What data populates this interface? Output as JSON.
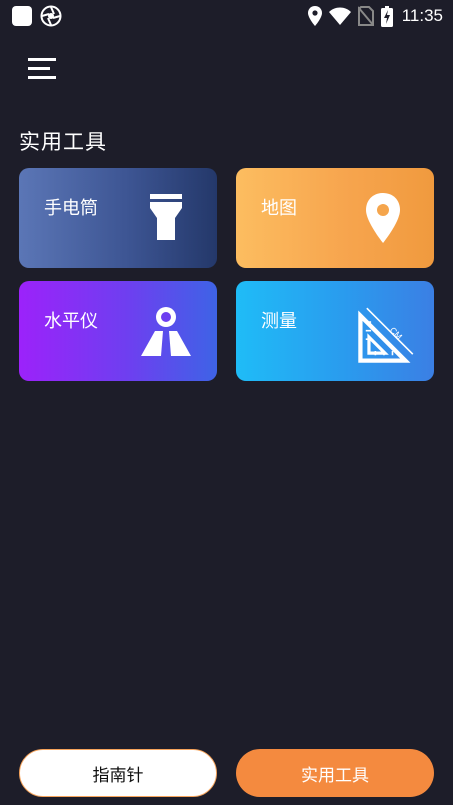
{
  "status_bar": {
    "time": "11:35",
    "icons": [
      "app-square-icon",
      "app-shutter-icon",
      "location-icon",
      "wifi-icon",
      "no-sim-icon",
      "battery-charging-icon"
    ]
  },
  "header": {
    "menu_icon": "hamburger-menu-icon"
  },
  "main": {
    "section_title": "实用工具",
    "tools": [
      {
        "label": "手电筒",
        "icon": "flashlight-icon",
        "colors": [
          "#5b76b6",
          "#24386a"
        ]
      },
      {
        "label": "地图",
        "icon": "map-pin-icon",
        "colors": [
          "#fcbd60",
          "#f09a3e"
        ]
      },
      {
        "label": "水平仪",
        "icon": "level-icon",
        "colors": [
          "#9c22fa",
          "#3e63e6"
        ]
      },
      {
        "label": "测量",
        "icon": "ruler-triangle-icon",
        "colors": [
          "#1fbcf7",
          "#3b7fe4"
        ],
        "icon_text": "CM"
      }
    ]
  },
  "bottom_nav": {
    "compass_label": "指南针",
    "tools_label": "实用工具",
    "active": "tools_label",
    "accent": "#f48a3f"
  },
  "theme": {
    "background": "#1d1d29"
  }
}
